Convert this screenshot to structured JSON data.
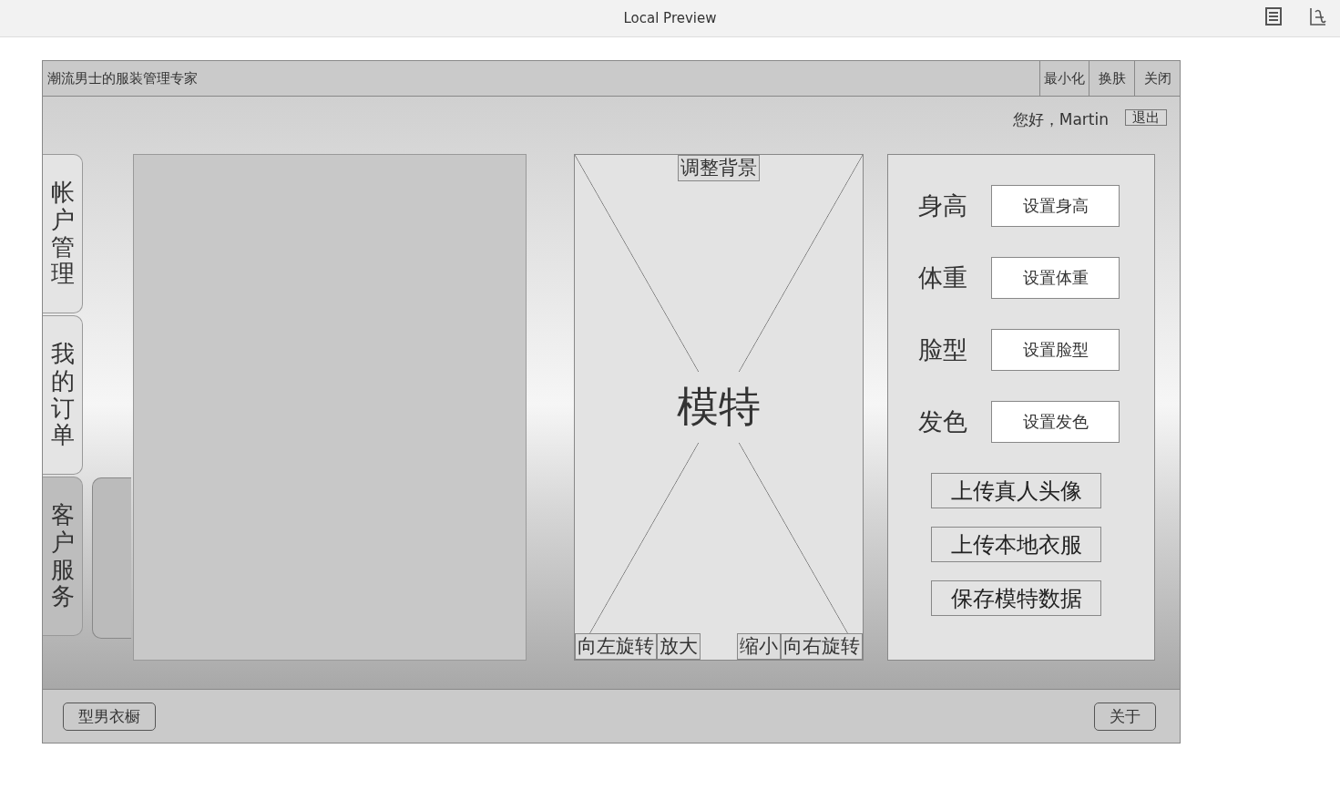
{
  "browser": {
    "title": "Local Preview"
  },
  "app": {
    "title": "潮流男士的服装管理专家",
    "window_buttons": [
      "最小化",
      "换肤",
      "关闭"
    ],
    "greeting": "您好，Martin",
    "logout": "退出",
    "tabs": [
      {
        "label": "帐户管理",
        "selected": false
      },
      {
        "label": "我的订单",
        "selected": false
      },
      {
        "label": "客户服务",
        "selected": true
      }
    ],
    "model": {
      "label": "模特",
      "top_button": "调整背景",
      "left_buttons": [
        "向左旋转",
        "放大"
      ],
      "right_buttons": [
        "缩小",
        "向右旋转"
      ]
    },
    "settings": [
      {
        "label": "身高",
        "button": "设置身高"
      },
      {
        "label": "体重",
        "button": "设置体重"
      },
      {
        "label": "脸型",
        "button": "设置脸型"
      },
      {
        "label": "发色",
        "button": "设置发色"
      }
    ],
    "actions": [
      "上传真人头像",
      "上传本地衣服",
      "保存模特数据"
    ],
    "footer": {
      "left_button": "型男衣橱",
      "right_button": "关于"
    }
  }
}
